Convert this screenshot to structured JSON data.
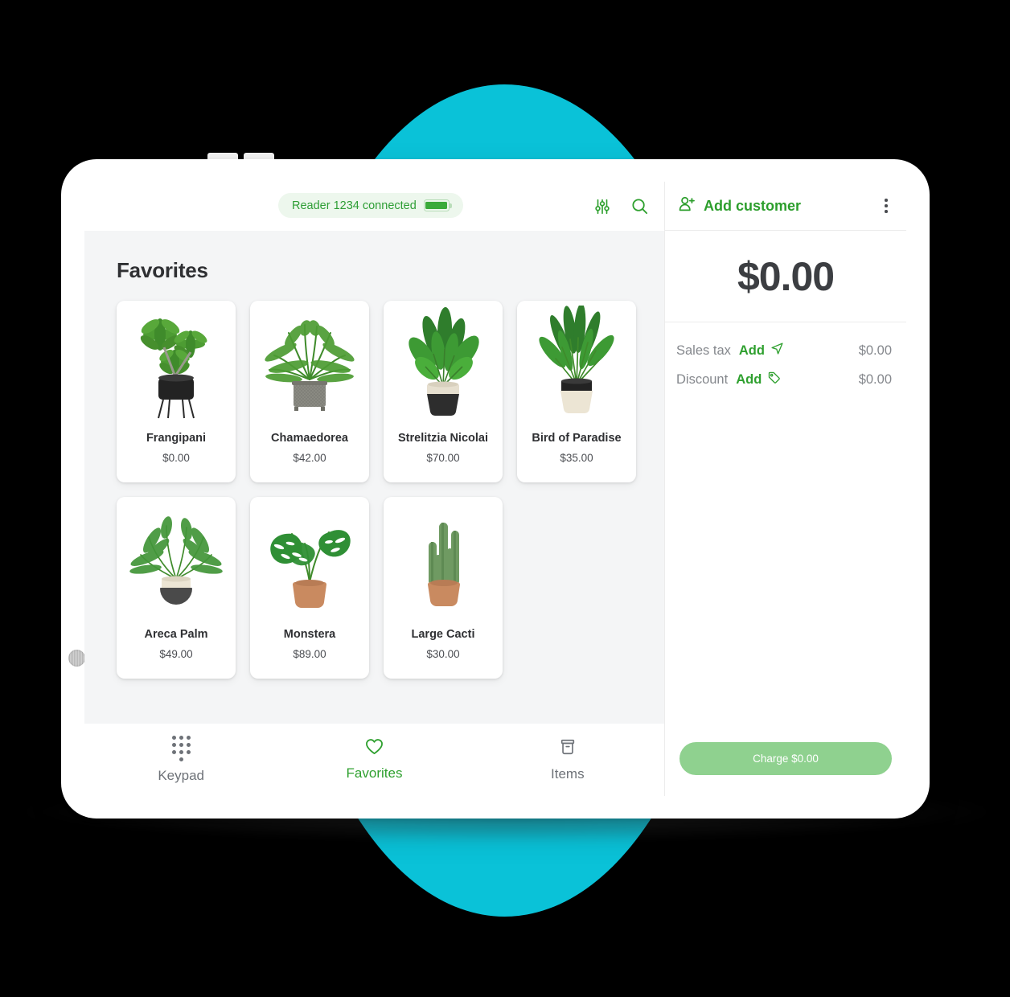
{
  "device": {
    "type": "tablet",
    "orientation": "landscape"
  },
  "colors": {
    "brand_cyan": "#0ac2d8",
    "accent_green": "#2fa02f",
    "charge_button_green": "#8fd18f",
    "text_dark": "#2f3033",
    "text_muted": "#85888d",
    "content_bg": "#f4f5f6"
  },
  "topbar": {
    "reader_status": "Reader 1234 connected",
    "battery_icon": "battery-full-icon",
    "filter_icon": "sliders-icon",
    "search_icon": "search-icon"
  },
  "main": {
    "section_title": "Favorites",
    "items": [
      {
        "name": "Frangipani",
        "price": "$0.00",
        "icon": "plant-frangipani"
      },
      {
        "name": "Chamaedorea",
        "price": "$42.00",
        "icon": "plant-chamaedorea"
      },
      {
        "name": "Strelitzia Nicolai",
        "price": "$70.00",
        "icon": "plant-strelitzia"
      },
      {
        "name": "Bird of Paradise",
        "price": "$35.00",
        "icon": "plant-bird-of-paradise"
      },
      {
        "name": "Areca Palm",
        "price": "$49.00",
        "icon": "plant-areca-palm"
      },
      {
        "name": "Monstera",
        "price": "$89.00",
        "icon": "plant-monstera"
      },
      {
        "name": "Large Cacti",
        "price": "$30.00",
        "icon": "plant-large-cacti"
      }
    ]
  },
  "bottom_nav": {
    "items": [
      {
        "label": "Keypad",
        "icon": "keypad-icon",
        "active": false
      },
      {
        "label": "Favorites",
        "icon": "heart-icon",
        "active": true
      },
      {
        "label": "Items",
        "icon": "archive-box-icon",
        "active": false
      }
    ]
  },
  "cart": {
    "add_customer_label": "Add customer",
    "add_customer_icon": "add-person-icon",
    "overflow_icon": "kebab-menu-icon",
    "total": "$0.00",
    "lines": [
      {
        "label": "Sales tax",
        "action": "Add",
        "action_icon": "location-arrow-icon",
        "amount": "$0.00"
      },
      {
        "label": "Discount",
        "action": "Add",
        "action_icon": "price-tag-icon",
        "amount": "$0.00"
      }
    ],
    "charge_label": "Charge $0.00"
  }
}
